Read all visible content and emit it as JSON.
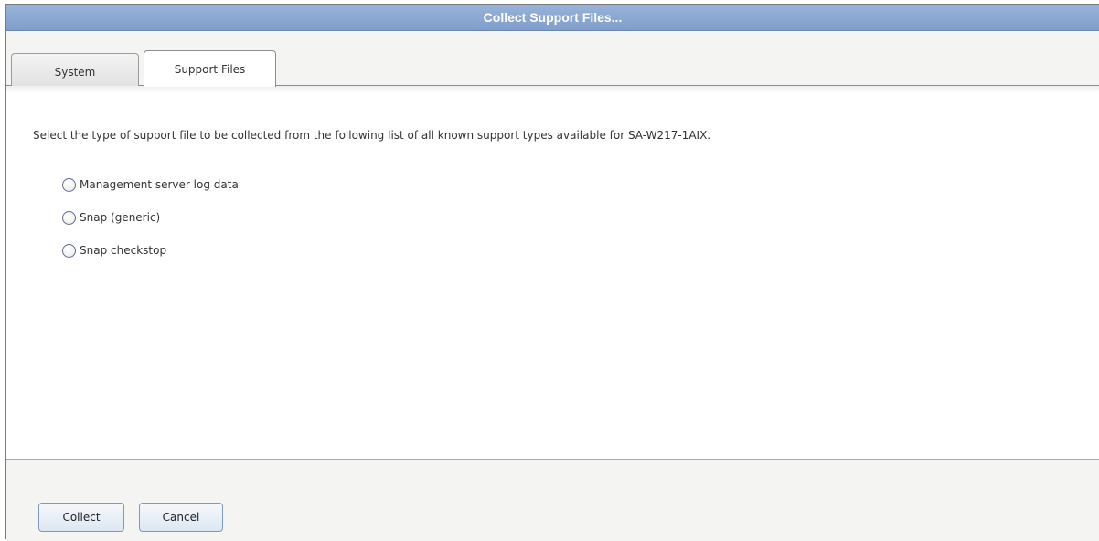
{
  "window": {
    "title": "Collect Support Files..."
  },
  "tabs": [
    {
      "label": "System",
      "selected": false
    },
    {
      "label": "Support Files",
      "selected": true
    }
  ],
  "content": {
    "instruction": "Select the type of support file to be collected from the following list of all known support types available for SA-W217-1AIX.",
    "options": [
      {
        "label": "Management server log data",
        "selected": false
      },
      {
        "label": "Snap (generic)",
        "selected": false
      },
      {
        "label": "Snap checkstop",
        "selected": false
      }
    ]
  },
  "footer": {
    "collect_label": "Collect",
    "cancel_label": "Cancel"
  },
  "colors": {
    "title_bar": "#8aa8d3",
    "button_border": "#7f9ab8",
    "radio_border": "#5b6f8c"
  }
}
